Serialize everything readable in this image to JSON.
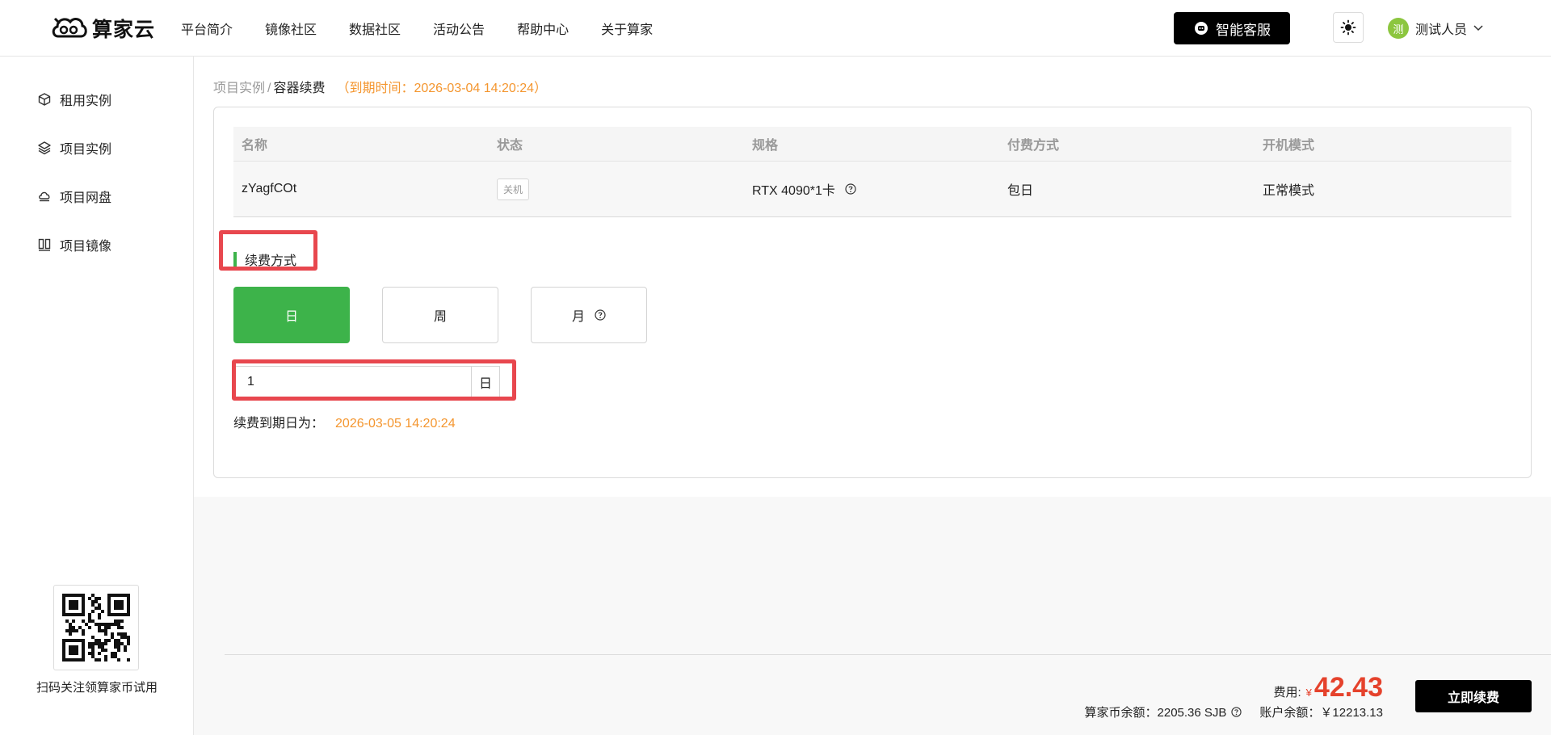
{
  "header": {
    "logo_text": "算家云",
    "nav": [
      "平台简介",
      "镜像社区",
      "数据社区",
      "活动公告",
      "帮助中心",
      "关于算家"
    ],
    "service_button": "智能客服",
    "user": {
      "avatar_char": "测",
      "name": "测试人员"
    }
  },
  "sidebar": {
    "items": [
      {
        "label": "租用实例",
        "icon": "cube-icon"
      },
      {
        "label": "项目实例",
        "icon": "layers-icon"
      },
      {
        "label": "项目网盘",
        "icon": "cloud-drive-icon"
      },
      {
        "label": "项目镜像",
        "icon": "mirror-icon"
      }
    ],
    "qr_caption": "扫码关注领算家币试用"
  },
  "breadcrumb": {
    "parent": "项目实例",
    "separator": "/",
    "current": "容器续费",
    "expire_note": "（到期时间：2026-03-04 14:20:24）"
  },
  "instance_table": {
    "columns": [
      "名称",
      "状态",
      "规格",
      "付费方式",
      "开机模式"
    ],
    "row": {
      "name": "zYagfCOt",
      "status": "关机",
      "spec": "RTX 4090*1卡",
      "pay_method": "包日",
      "boot_mode": "正常模式"
    }
  },
  "renewal": {
    "section_title": "续费方式",
    "periods": [
      "日",
      "周",
      "月"
    ],
    "selected_period": "日",
    "quantity": "1",
    "quantity_unit": "日",
    "expire_label": "续费到期日为：",
    "expire_value": "2026-03-05 14:20:24"
  },
  "summary": {
    "fee_label": "费用:",
    "currency": "¥",
    "fee_value": "42.43",
    "coin_balance": "算家币余额：2205.36 SJB",
    "account_balance": "账户余额：￥12213.13",
    "renew_button": "立即续费"
  },
  "colors": {
    "accent_green": "#3db34a",
    "orange_text": "#f4962f",
    "price_red": "#e5422c",
    "highlight_red": "#e8474e"
  }
}
